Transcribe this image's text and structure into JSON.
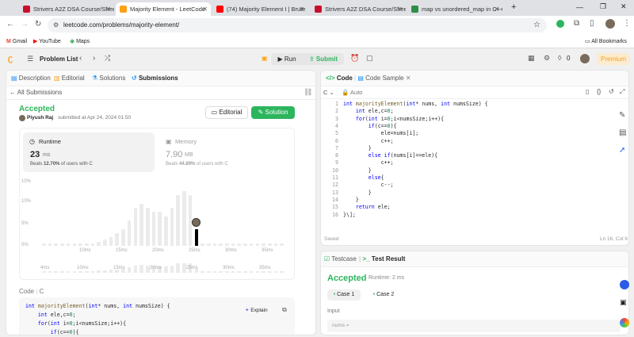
{
  "browser": {
    "tabs": [
      {
        "label": "Strivers A2Z DSA Course/Shee",
        "color": "#c8102e"
      },
      {
        "label": "Majority Element - LeetCode",
        "color": "#ffa116",
        "active": true
      },
      {
        "label": "(74) Majority Element I | Brute",
        "color": "#ff0000"
      },
      {
        "label": "Strivers A2Z DSA Course/Shee",
        "color": "#c8102e"
      },
      {
        "label": "map vs unordered_map in C++",
        "color": "#2f8d46"
      }
    ],
    "url": "leetcode.com/problems/majority-element/",
    "bookmarks": [
      "Gmail",
      "YouTube",
      "Maps"
    ],
    "all_bookmarks": "All Bookmarks"
  },
  "nav": {
    "problem_list": "Problem List",
    "run": "Run",
    "submit": "Submit",
    "streak": "0",
    "premium": "Premium"
  },
  "left": {
    "tabs": [
      "Description",
      "Editorial",
      "Solutions",
      "Submissions"
    ],
    "back": "All Submissions",
    "status": "Accepted",
    "user": "Piyush Raj",
    "submitted": "submitted at Apr 24, 2024 01:50",
    "editorial_btn": "Editorial",
    "solution_btn": "Solution",
    "runtime_label": "Runtime",
    "runtime_value": "23",
    "runtime_unit": "ms",
    "runtime_beats": "Beats",
    "runtime_pct": "12.70%",
    "runtime_suffix": "of users with C",
    "memory_label": "Memory",
    "memory_value": "7.90",
    "memory_unit": "MB",
    "memory_beats": "Beats",
    "memory_pct": "44.89%",
    "memory_suffix": "of users with C",
    "code_label": "Code",
    "code_lang": "C",
    "explain": "Explain"
  },
  "chart_data": {
    "type": "bar",
    "yticks": [
      "10%",
      "10%",
      "5%",
      "0%"
    ],
    "xticks": [
      "10ms",
      "15ms",
      "20ms",
      "25ms",
      "30ms",
      "35ms"
    ],
    "mini_xticks": [
      "4ms",
      "10ms",
      "15ms",
      "20ms",
      "25ms",
      "30ms",
      "35ms"
    ],
    "values": [
      0.5,
      0.5,
      0.5,
      0.5,
      0.5,
      0.5,
      0.5,
      0.5,
      0.5,
      1,
      1.5,
      2,
      3,
      4,
      6,
      9,
      10,
      9,
      8,
      8,
      7,
      9,
      12,
      13,
      12,
      4,
      0.5,
      0.5,
      0.5,
      0.5,
      0.5,
      0.5,
      0.5,
      0.5,
      0.5,
      0.5,
      0.5,
      0.5,
      0.5,
      0.5
    ],
    "highlight_index": 25,
    "ylim": [
      0,
      15
    ]
  },
  "right": {
    "code_tab": "Code",
    "sample_tab": "Code Sample",
    "lang": "C",
    "auto": "Auto",
    "saved": "Saved",
    "cursor": "Ln 16, Col 6"
  },
  "code_lines": [
    "int majorityElement(int* nums, int numsSize) {",
    "    int ele,c=0;",
    "    for(int i=0;i<numsSize;i++){",
    "        if(c==0){",
    "            ele=nums[i];",
    "            c++;",
    "        }",
    "        else if(nums[i]==ele){",
    "            c++;",
    "        }",
    "        else{",
    "            c--;",
    "        }",
    "    }",
    "    return ele;",
    "}\\];"
  ],
  "left_code_lines": [
    "int majorityElement(int* nums, int numsSize) {",
    "    int ele,c=0;",
    "    for(int i=0;i<numsSize;i++){",
    "        if(c==0){"
  ],
  "bottom": {
    "testcase_tab": "Testcase",
    "result_tab": "Test Result",
    "status": "Accepted",
    "runtime": "Runtime: 2 ms",
    "case1": "Case 1",
    "case2": "Case 2",
    "input_label": "Input",
    "input_value": "nums ="
  }
}
